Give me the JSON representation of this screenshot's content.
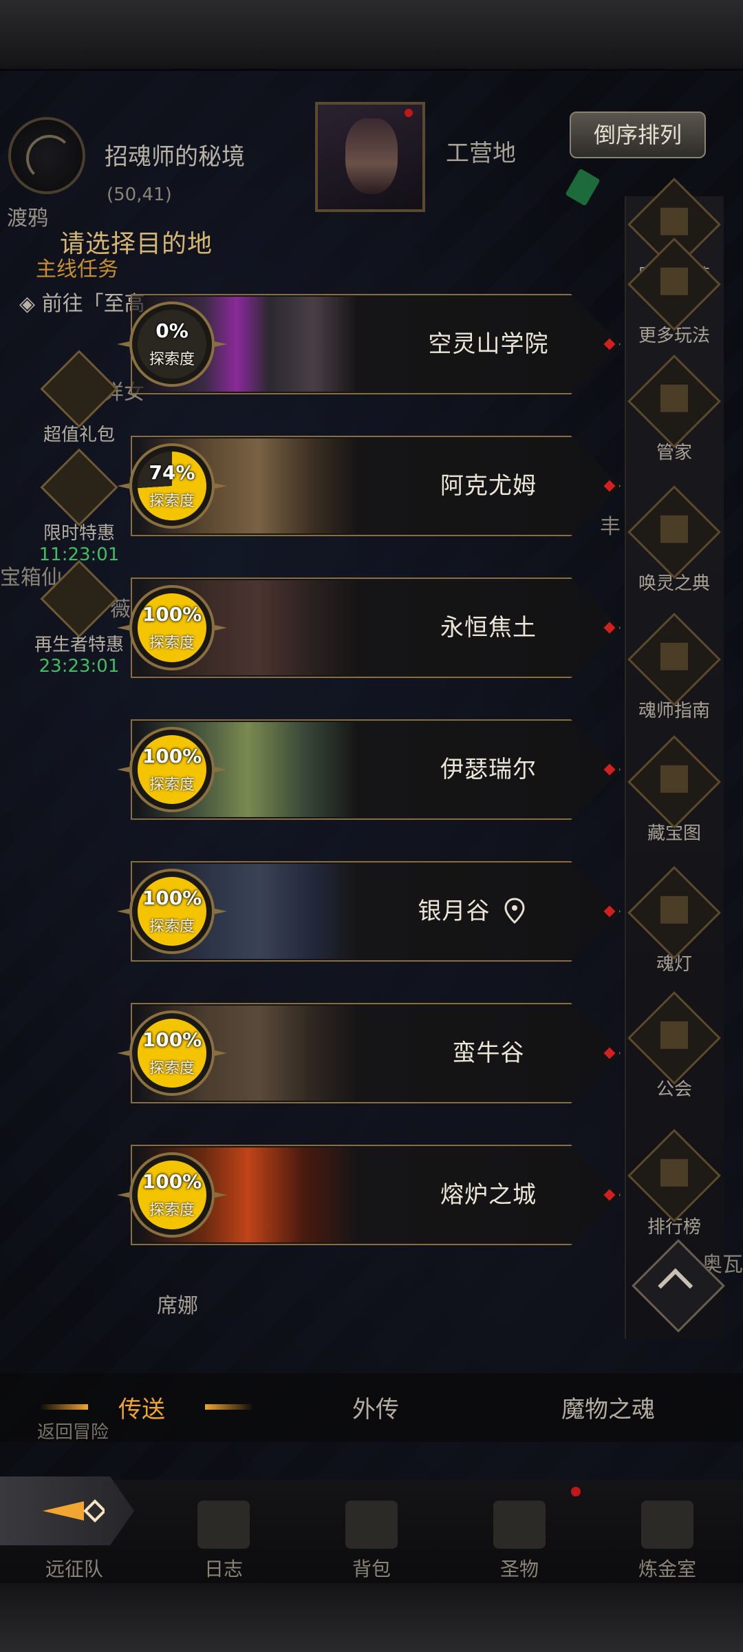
{
  "header": {
    "location_name": "招魂师的秘境",
    "location_coords": "(50,41)",
    "ferry_label": "渡鸦",
    "camp_label": "工营地",
    "sort_button": "倒序排列",
    "title": "请选择目的地"
  },
  "left_panel": {
    "quest_title": "主线任务",
    "quest_text": "◈ 前往「至高",
    "extra_faint_1": "详女",
    "extra_faint_2": "宝箱仙",
    "extra_faint_3": "薇",
    "items": [
      {
        "label": "超值礼包",
        "timer": ""
      },
      {
        "label": "限时特惠",
        "timer": "11:23:01"
      },
      {
        "label": "再生者特惠",
        "timer": "23:23:01"
      }
    ],
    "npc_label": "席娜"
  },
  "destinations": [
    {
      "name": "空灵山学院",
      "progress_text": "0%",
      "progress": 0,
      "sub": "探索度",
      "current": false
    },
    {
      "name": "阿克尤姆",
      "progress_text": "74%",
      "progress": 74,
      "sub": "探索度",
      "current": false
    },
    {
      "name": "永恒焦土",
      "progress_text": "100%",
      "progress": 100,
      "sub": "探索度",
      "current": false
    },
    {
      "name": "伊瑟瑞尔",
      "progress_text": "100%",
      "progress": 100,
      "sub": "探索度",
      "current": false
    },
    {
      "name": "银月谷",
      "progress_text": "100%",
      "progress": 100,
      "sub": "探索度",
      "current": true
    },
    {
      "name": "蛮牛谷",
      "progress_text": "100%",
      "progress": 100,
      "sub": "探索度",
      "current": false
    },
    {
      "name": "熔炉之城",
      "progress_text": "100%",
      "progress": 100,
      "sub": "探索度",
      "current": false
    }
  ],
  "right_sidebar": [
    {
      "label": "阵容推荐",
      "icon": "thumbs-up-icon"
    },
    {
      "label": "更多玩法",
      "icon": "gift-icon"
    },
    {
      "label": "管家",
      "icon": "scroll-quill-icon"
    },
    {
      "label": "唤灵之典",
      "icon": "book-icon"
    },
    {
      "label": "魂师指南",
      "icon": "guide-icon"
    },
    {
      "label": "藏宝图",
      "icon": "treasure-map-icon"
    },
    {
      "label": "魂灯",
      "icon": "lamp-icon"
    },
    {
      "label": "公会",
      "icon": "guild-icon"
    },
    {
      "label": "排行榜",
      "icon": "trophy-icon"
    }
  ],
  "right_faint": {
    "a": "丰",
    "b": "奥瓦"
  },
  "tabs": {
    "teleport": "传送",
    "side_story": "外传",
    "monster_soul": "魔物之魂",
    "back_label": "返回冒险"
  },
  "nav": [
    {
      "label": "远征队",
      "icon": "expedition-icon"
    },
    {
      "label": "日志",
      "icon": "journal-icon"
    },
    {
      "label": "背包",
      "icon": "backpack-icon"
    },
    {
      "label": "圣物",
      "icon": "relic-icon"
    },
    {
      "label": "炼金室",
      "icon": "alchemy-icon"
    }
  ],
  "colors": {
    "accent_gold": "#f0a630",
    "progress_yellow": "#f5c400",
    "frame_bronze": "#8a6e3e",
    "notify_red": "#d02020"
  }
}
